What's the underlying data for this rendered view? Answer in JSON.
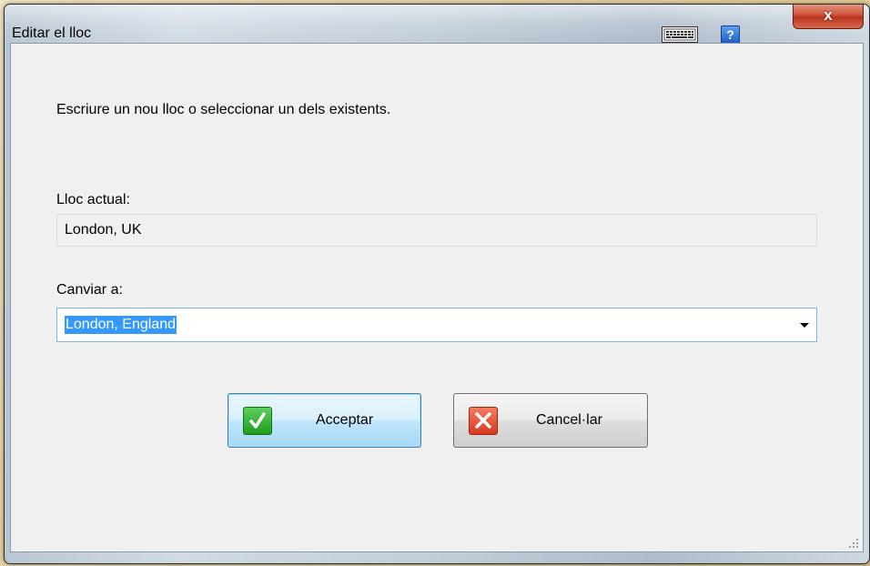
{
  "window": {
    "title": "Editar el lloc",
    "close_label": "x",
    "help_label": "?"
  },
  "dialog": {
    "instruction": "Escriure un nou lloc o seleccionar un dels existents.",
    "current_label": "Lloc actual:",
    "current_value": "London, UK",
    "change_label": "Canviar a:",
    "change_value": "London, England"
  },
  "buttons": {
    "ok_label": "Acceptar",
    "cancel_label": "Cancel·lar"
  },
  "icons": {
    "keyboard": "keyboard-icon",
    "help": "help-icon",
    "close": "close-icon",
    "check": "checkmark-icon",
    "cancel": "x-icon",
    "dropdown": "chevron-down-icon",
    "grip": "resize-grip-icon"
  },
  "colors": {
    "selection": "#3399ff",
    "ok_icon": "#1e9b1e",
    "cancel_icon": "#d93a1f",
    "close_button": "#c7432a",
    "help_icon": "#1f5fc8"
  }
}
